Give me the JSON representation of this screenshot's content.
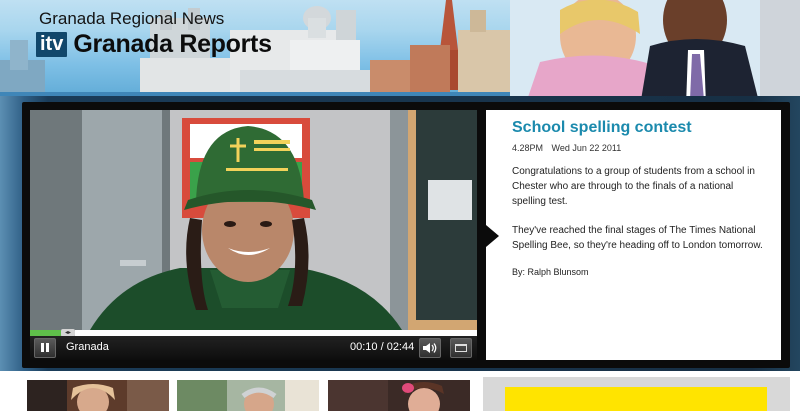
{
  "header": {
    "region": "Granada Regional News",
    "logo_text": "itv",
    "title": "Granada Reports"
  },
  "player": {
    "channel": "Granada",
    "time": "00:10 / 02:44",
    "progress_fraction": 0.0061,
    "buffered_fraction": 1.0,
    "icons": [
      "pause-icon",
      "volume-icon",
      "fullscreen-icon"
    ]
  },
  "article": {
    "title": "School spelling contest",
    "time": "4.28PM",
    "date": "Wed Jun 22 2011",
    "paragraphs": [
      "Congratulations to a group of students from a school in Chester who are through to the finals of a national spelling test.",
      "They've reached the final stages of The Times National Spelling Bee, so they're heading off to London tomorrow."
    ],
    "byline": "By: Ralph Blunsom"
  },
  "colors": {
    "accent": "#1b8aad",
    "panel": "#0b0b0b",
    "progress": "#5fbf4a",
    "promo_yellow": "#ffe400",
    "logo_bg": "#11476b"
  }
}
